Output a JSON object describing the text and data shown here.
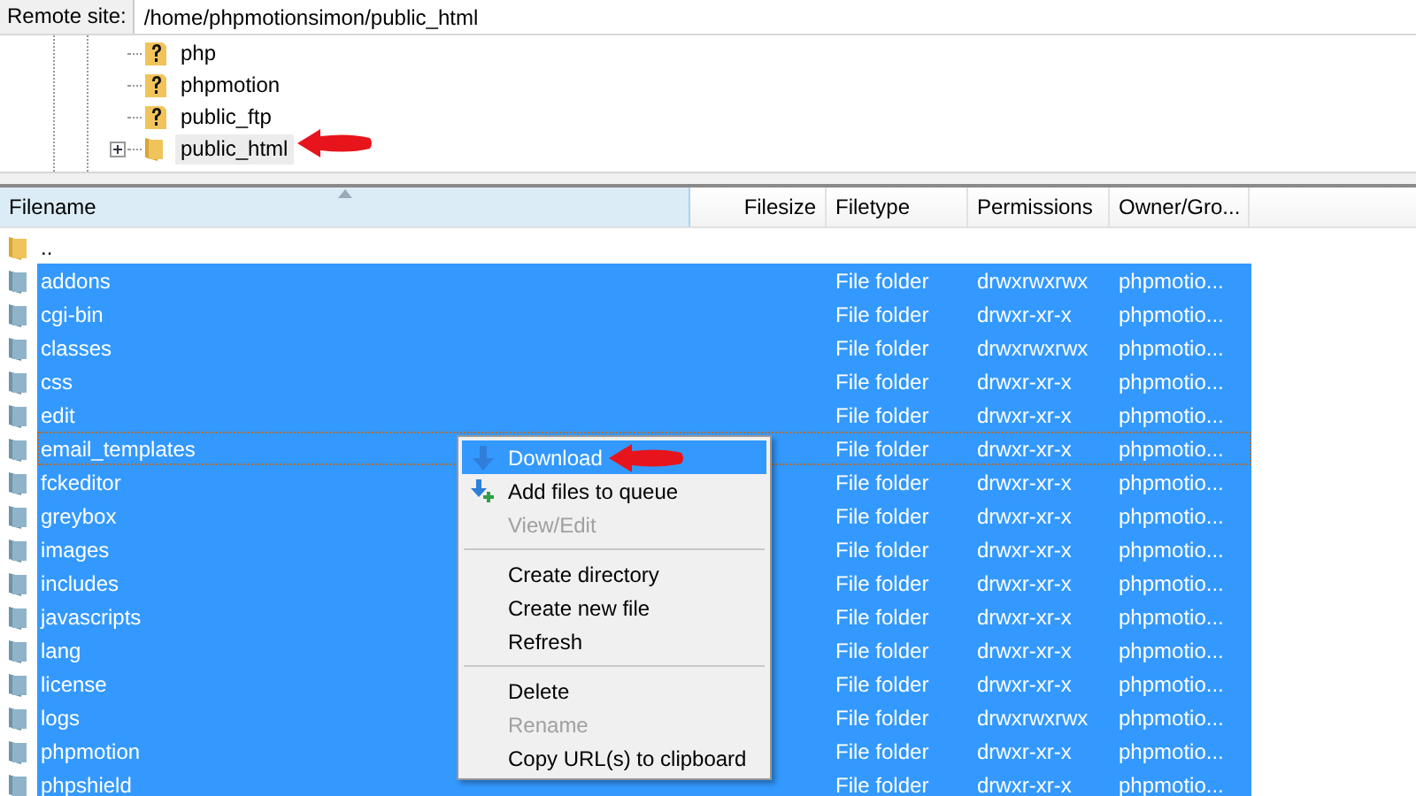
{
  "remote_site": {
    "label": "Remote site:",
    "path": "/home/phpmotionsimon/public_html"
  },
  "tree": [
    {
      "label": "php",
      "kind": "unknown",
      "expandable": false,
      "selected": false
    },
    {
      "label": "phpmotion",
      "kind": "unknown",
      "expandable": false,
      "selected": false
    },
    {
      "label": "public_ftp",
      "kind": "unknown",
      "expandable": false,
      "selected": false
    },
    {
      "label": "public_html",
      "kind": "folder",
      "expandable": true,
      "selected": true
    }
  ],
  "table": {
    "columns": [
      {
        "label": "Filename",
        "sorted": true
      },
      {
        "label": "Filesize",
        "sorted": false
      },
      {
        "label": "Filetype",
        "sorted": false
      },
      {
        "label": "Permissions",
        "sorted": false
      },
      {
        "label": "Owner/Gro...",
        "sorted": false
      }
    ],
    "rows": [
      {
        "name": "..",
        "filetype": "",
        "permissions": "",
        "owner": "",
        "selected": false,
        "focused": false
      },
      {
        "name": "addons",
        "filetype": "File folder",
        "permissions": "drwxrwxrwx",
        "owner": "phpmotio...",
        "selected": true,
        "focused": false
      },
      {
        "name": "cgi-bin",
        "filetype": "File folder",
        "permissions": "drwxr-xr-x",
        "owner": "phpmotio...",
        "selected": true,
        "focused": false
      },
      {
        "name": "classes",
        "filetype": "File folder",
        "permissions": "drwxrwxrwx",
        "owner": "phpmotio...",
        "selected": true,
        "focused": false
      },
      {
        "name": "css",
        "filetype": "File folder",
        "permissions": "drwxr-xr-x",
        "owner": "phpmotio...",
        "selected": true,
        "focused": false
      },
      {
        "name": "edit",
        "filetype": "File folder",
        "permissions": "drwxr-xr-x",
        "owner": "phpmotio...",
        "selected": true,
        "focused": false
      },
      {
        "name": "email_templates",
        "filetype": "File folder",
        "permissions": "drwxr-xr-x",
        "owner": "phpmotio...",
        "selected": true,
        "focused": true
      },
      {
        "name": "fckeditor",
        "filetype": "File folder",
        "permissions": "drwxr-xr-x",
        "owner": "phpmotio...",
        "selected": true,
        "focused": false
      },
      {
        "name": "greybox",
        "filetype": "File folder",
        "permissions": "drwxr-xr-x",
        "owner": "phpmotio...",
        "selected": true,
        "focused": false
      },
      {
        "name": "images",
        "filetype": "File folder",
        "permissions": "drwxr-xr-x",
        "owner": "phpmotio...",
        "selected": true,
        "focused": false
      },
      {
        "name": "includes",
        "filetype": "File folder",
        "permissions": "drwxr-xr-x",
        "owner": "phpmotio...",
        "selected": true,
        "focused": false
      },
      {
        "name": "javascripts",
        "filetype": "File folder",
        "permissions": "drwxr-xr-x",
        "owner": "phpmotio...",
        "selected": true,
        "focused": false
      },
      {
        "name": "lang",
        "filetype": "File folder",
        "permissions": "drwxr-xr-x",
        "owner": "phpmotio...",
        "selected": true,
        "focused": false
      },
      {
        "name": "license",
        "filetype": "File folder",
        "permissions": "drwxr-xr-x",
        "owner": "phpmotio...",
        "selected": true,
        "focused": false
      },
      {
        "name": "logs",
        "filetype": "File folder",
        "permissions": "drwxrwxrwx",
        "owner": "phpmotio...",
        "selected": true,
        "focused": false
      },
      {
        "name": "phpmotion",
        "filetype": "File folder",
        "permissions": "drwxr-xr-x",
        "owner": "phpmotio...",
        "selected": true,
        "focused": false
      },
      {
        "name": "phpshield",
        "filetype": "File folder",
        "permissions": "drwxr-xr-x",
        "owner": "phpmotio...",
        "selected": true,
        "focused": false
      }
    ]
  },
  "context_menu": [
    {
      "kind": "download",
      "label": "Download",
      "disabled": false,
      "selected": true
    },
    {
      "kind": "queue",
      "label": "Add files to queue",
      "disabled": false,
      "selected": false
    },
    {
      "kind": "item",
      "label": "View/Edit",
      "disabled": true,
      "selected": false
    },
    {
      "kind": "separator"
    },
    {
      "kind": "item",
      "label": "Create directory",
      "disabled": false,
      "selected": false
    },
    {
      "kind": "item",
      "label": "Create new file",
      "disabled": false,
      "selected": false
    },
    {
      "kind": "item",
      "label": "Refresh",
      "disabled": false,
      "selected": false
    },
    {
      "kind": "separator"
    },
    {
      "kind": "item",
      "label": "Delete",
      "disabled": false,
      "selected": false
    },
    {
      "kind": "item",
      "label": "Rename",
      "disabled": true,
      "selected": false
    },
    {
      "kind": "item",
      "label": "Copy URL(s) to clipboard",
      "disabled": false,
      "selected": false
    }
  ]
}
